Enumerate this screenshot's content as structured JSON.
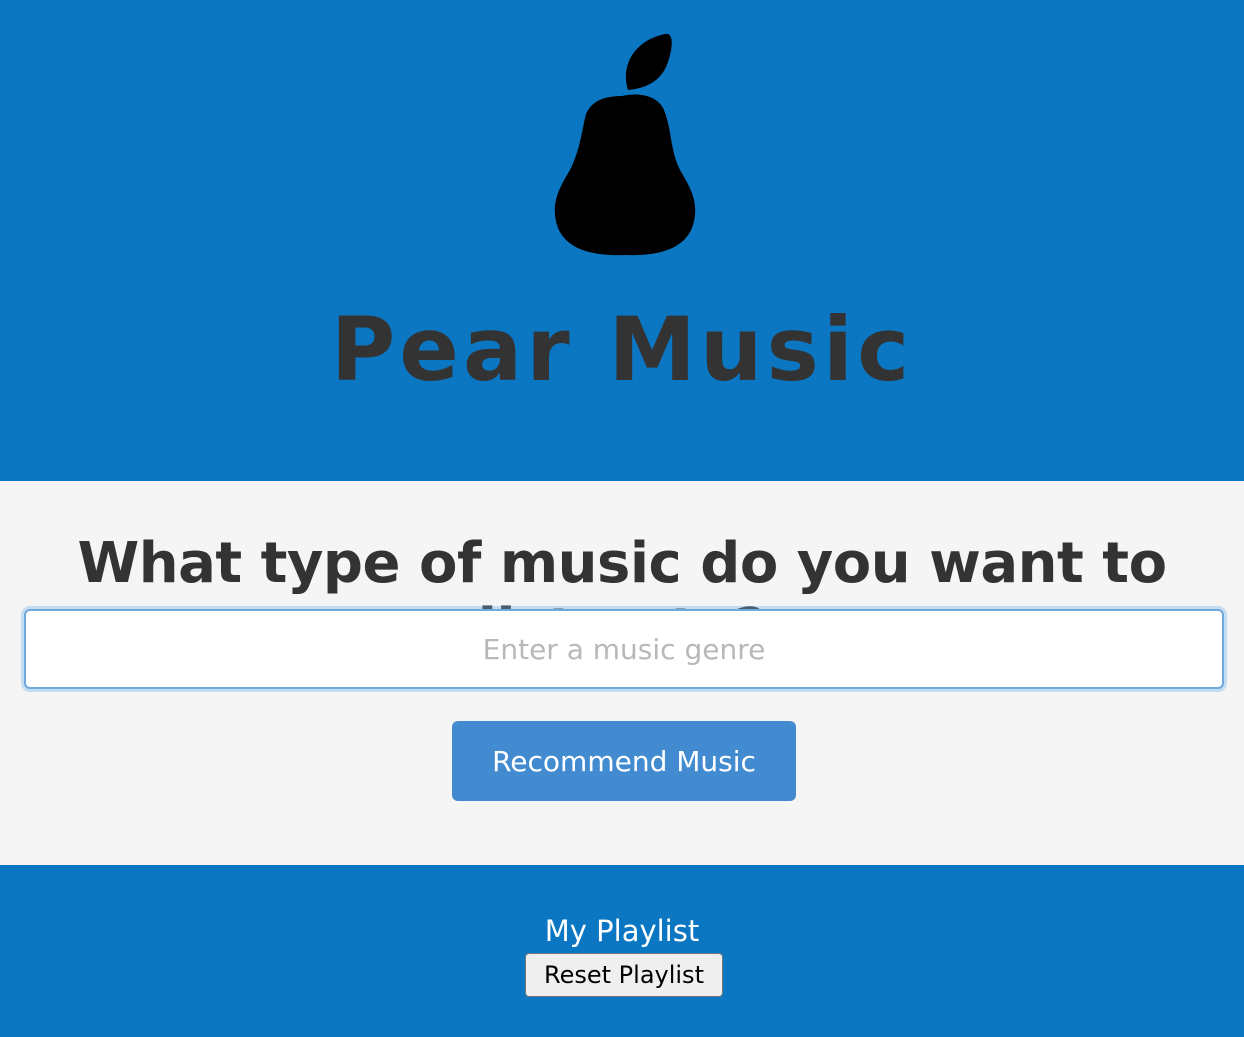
{
  "header": {
    "logo_icon": "pear-icon",
    "title": "Pear Music",
    "background_color": "#0b77c3",
    "title_color": "#333333"
  },
  "main": {
    "question": "What type of music do you want to listen to?",
    "genre_input": {
      "value": "",
      "placeholder": "Enter a music genre"
    },
    "recommend_button_label": "Recommend Music",
    "background_color": "#f5f5f5",
    "button_color": "#428bd0"
  },
  "footer": {
    "playlist_title": "My Playlist",
    "reset_button_label": "Reset Playlist",
    "background_color": "#0b77c3"
  }
}
